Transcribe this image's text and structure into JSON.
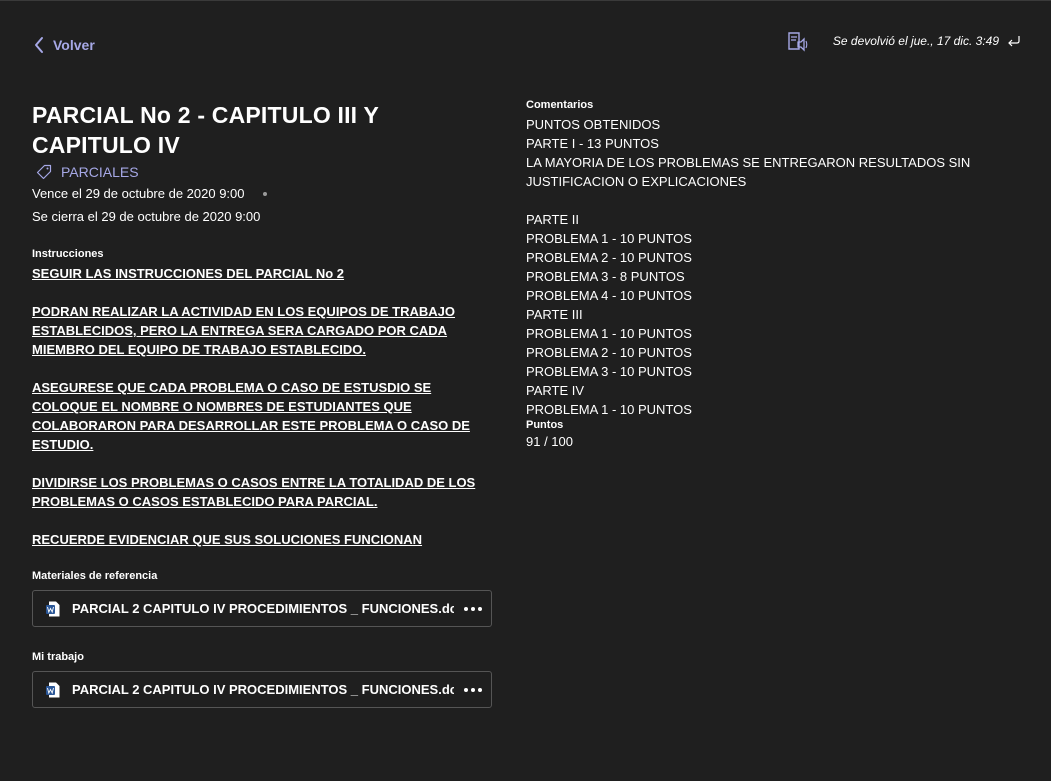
{
  "nav": {
    "back_label": "Volver"
  },
  "header": {
    "returned_text": "Se devolvió el jue., 17 dic. 3:49"
  },
  "assignment": {
    "title": "PARCIAL No 2 - CAPITULO III Y CAPITULO IV",
    "category": "PARCIALES",
    "due": "Vence el 29 de octubre de 2020 9:00",
    "closes": "Se cierra el 29 de octubre de 2020 9:00"
  },
  "instructions": {
    "label": "Instrucciones",
    "paragraphs": [
      "SEGUIR LAS INSTRUCCIONES DEL PARCIAL No 2",
      "PODRAN REALIZAR LA ACTIVIDAD EN LOS EQUIPOS DE TRABAJO ESTABLECIDOS, PERO LA ENTREGA SERA CARGADO POR CADA MIEMBRO DEL EQUIPO DE TRABAJO ESTABLECIDO.",
      "ASEGURESE QUE CADA PROBLEMA O CASO DE ESTUSDIO SE COLOQUE EL NOMBRE O NOMBRES DE ESTUDIANTES QUE COLABORARON PARA DESARROLLAR ESTE PROBLEMA O CASO DE ESTUDIO.",
      "DIVIDIRSE LOS PROBLEMAS O CASOS ENTRE LA TOTALIDAD DE LOS PROBLEMAS O CASOS ESTABLECIDO PARA PARCIAL.",
      "RECUERDE EVIDENCIAR QUE SUS SOLUCIONES FUNCIONAN"
    ]
  },
  "reference": {
    "label": "Materiales de referencia",
    "file_name": "PARCIAL 2 CAPITULO IV PROCEDIMIENTOS _ FUNCIONES.dc"
  },
  "my_work": {
    "label": "Mi trabajo",
    "file_name": "PARCIAL 2 CAPITULO IV PROCEDIMIENTOS _ FUNCIONES.dc"
  },
  "feedback": {
    "comments_label": "Comentarios",
    "comments_lines": [
      "PUNTOS OBTENIDOS",
      "PARTE I - 13 PUNTOS",
      "LA MAYORIA DE LOS PROBLEMAS SE ENTREGARON RESULTADOS SIN",
      "JUSTIFICACION O EXPLICACIONES",
      "",
      "PARTE II",
      "PROBLEMA 1 - 10 PUNTOS",
      "PROBLEMA 2 - 10 PUNTOS",
      "PROBLEMA 3 - 8 PUNTOS",
      "PROBLEMA 4 -  10 PUNTOS",
      "PARTE III",
      "PROBLEMA 1 - 10 PUNTOS",
      "PROBLEMA 2 -  10 PUNTOS",
      "PROBLEMA 3 -  10 PUNTOS",
      "PARTE IV",
      "PROBLEMA 1 - 10 PUNTOS"
    ],
    "points_label": "Puntos",
    "points_value": "91 / 100"
  },
  "colors": {
    "background": "#1f1f1f",
    "accent": "#a6a8e6",
    "text": "#ffffff",
    "border": "#555555"
  },
  "icons": [
    "chevron-left-icon",
    "immersive-reader-icon",
    "return-arrow-icon",
    "tag-icon",
    "word-doc-icon",
    "more-options-icon"
  ]
}
